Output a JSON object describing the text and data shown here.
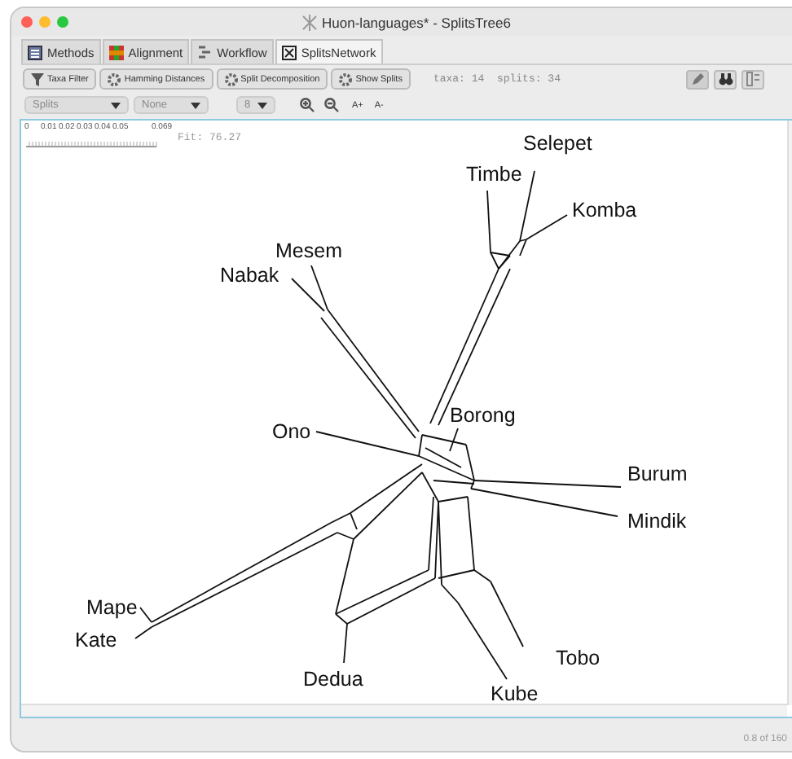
{
  "window": {
    "title": "Huon-languages* - SplitsTree6"
  },
  "tabs": [
    {
      "label": "Methods",
      "selected": false
    },
    {
      "label": "Alignment",
      "selected": false
    },
    {
      "label": "Workflow",
      "selected": false
    },
    {
      "label": "SplitsNetwork",
      "selected": true
    }
  ],
  "toolbar": {
    "buttons": [
      "Taxa Filter",
      "Hamming Distances",
      "Split Decomposition",
      "Show Splits"
    ],
    "info": "taxa: 14  splits: 34"
  },
  "view_controls": {
    "dropdowns": [
      {
        "value": "Splits",
        "disabled": true
      },
      {
        "value": "None",
        "disabled": true
      },
      {
        "value": "8",
        "disabled": true
      }
    ],
    "font_buttons": [
      "A+",
      "A-"
    ]
  },
  "network": {
    "scale_labels": [
      "0",
      "0.01",
      "0.02",
      "0.03",
      "0.04",
      "0.05",
      "0.069"
    ],
    "fit": "Fit: 76.27",
    "taxa": [
      {
        "label": "Selepet"
      },
      {
        "label": "Timbe"
      },
      {
        "label": "Komba"
      },
      {
        "label": "Mesem"
      },
      {
        "label": "Nabak"
      },
      {
        "label": "Ono"
      },
      {
        "label": "Borong"
      },
      {
        "label": "Burum"
      },
      {
        "label": "Mindik"
      },
      {
        "label": "Mape"
      },
      {
        "label": "Kate"
      },
      {
        "label": "Dedua"
      },
      {
        "label": "Kube"
      },
      {
        "label": "Tobo"
      }
    ]
  },
  "status_bar": {
    "text": "0.8 of 160"
  }
}
